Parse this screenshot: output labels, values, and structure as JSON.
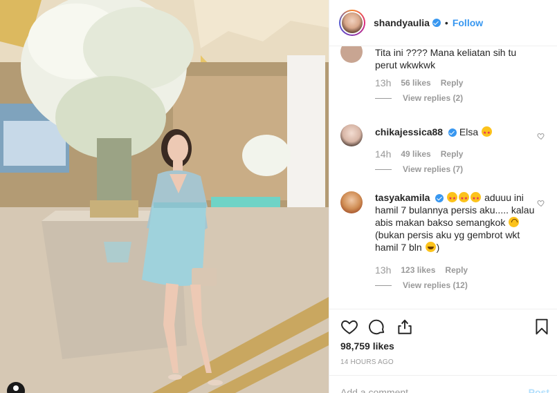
{
  "post": {
    "username": "shandyaulia",
    "dot": "•",
    "follow_label": "Follow"
  },
  "comments": [
    {
      "text": "Tita ini ???? Mana keliatan sih tu perut wkwkwk",
      "time": "13h",
      "likes": "56 likes",
      "reply": "Reply",
      "view_replies": "View replies (2)"
    },
    {
      "username": "chikajessica88",
      "text": "Elsa",
      "emoji": [
        "star-struck"
      ],
      "time": "14h",
      "likes": "49 likes",
      "reply": "Reply",
      "view_replies": "View replies (7)"
    },
    {
      "username": "tasyakamila",
      "text_1": "aduuu ini hamil 7 bulannya persis aku..... kalau abis makan bakso semangkok",
      "text_2": "(bukan persis aku yg gembrot wkt hamil 7 bln",
      "text_3": ")",
      "emoji": [
        "star-struck",
        "star-struck",
        "star-struck",
        "upside-down-face",
        "rolling-on-floor-laughing"
      ],
      "time": "13h",
      "likes": "123 likes",
      "reply": "Reply",
      "view_replies": "View replies (12)"
    }
  ],
  "actions": {
    "icons": [
      "heart-icon",
      "comment-icon",
      "share-icon",
      "bookmark-icon"
    ],
    "likes": "98,759 likes",
    "timestamp": "14 HOURS AGO"
  },
  "composer": {
    "placeholder": "Add a comment...",
    "post_label": "Post"
  },
  "colors": {
    "accent": "#3897f0",
    "muted": "#999999",
    "border": "#efefef"
  }
}
